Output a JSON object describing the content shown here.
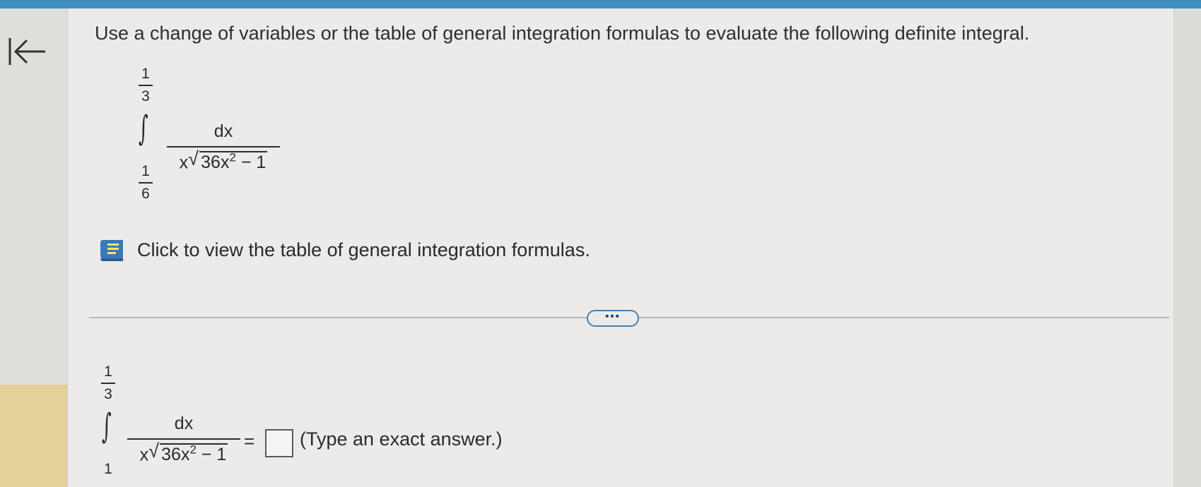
{
  "question": {
    "instruction": "Use a change of variables or the table of general integration formulas to evaluate the following definite integral."
  },
  "integral": {
    "upper_num": "1",
    "upper_den": "3",
    "lower_num": "1",
    "lower_den": "6",
    "numerator": "dx",
    "denominator_prefix": "x",
    "radicand_base": "36x",
    "radicand_exponent": "2",
    "radicand_suffix": " − 1"
  },
  "formula_link": {
    "label": "Click to view the table of general integration formulas."
  },
  "more_button": {
    "label": "•••"
  },
  "answer": {
    "equals": "=",
    "value": "",
    "hint": "(Type an exact answer.)"
  },
  "icons": {
    "back": "back-to-start-icon",
    "formula": "book-icon"
  },
  "colors": {
    "top_bar": "#3e8fbf",
    "book_icon": "#3a78b8",
    "left_panel_yellow": "#e2d29a"
  }
}
